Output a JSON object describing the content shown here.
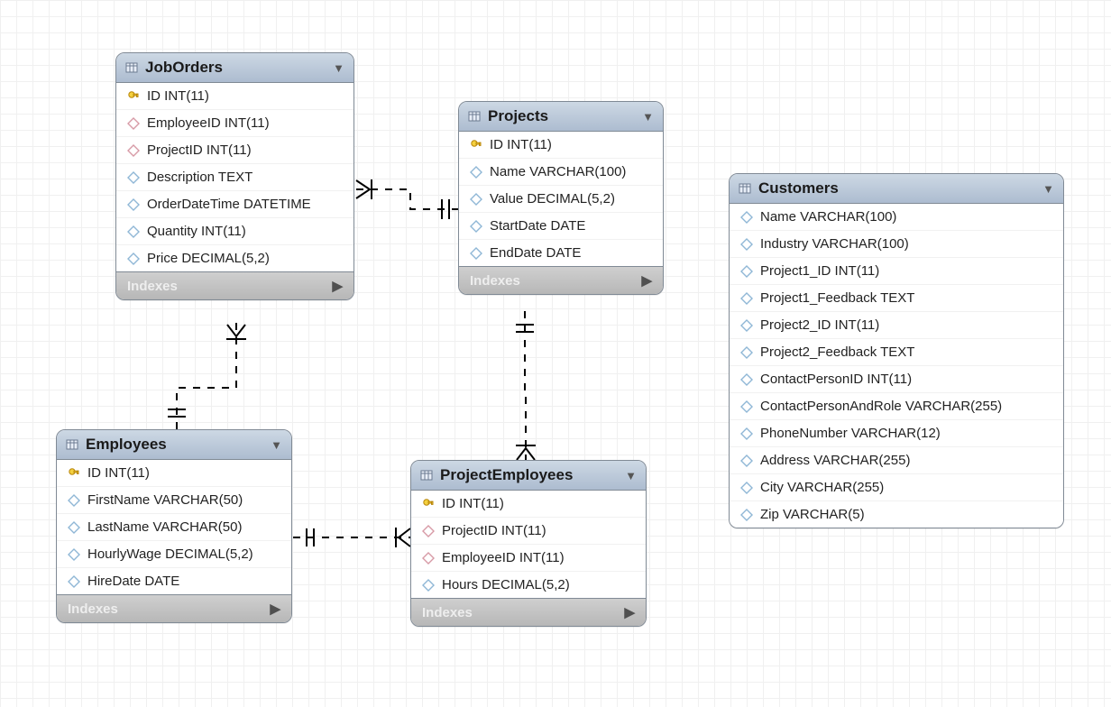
{
  "entities": {
    "joborders": {
      "title": "JobOrders",
      "indexesLabel": "Indexes",
      "columns": [
        {
          "name": "ID INT(11)",
          "type": "pk"
        },
        {
          "name": "EmployeeID INT(11)",
          "type": "fk"
        },
        {
          "name": "ProjectID INT(11)",
          "type": "fk"
        },
        {
          "name": "Description TEXT",
          "type": "col"
        },
        {
          "name": "OrderDateTime DATETIME",
          "type": "col"
        },
        {
          "name": "Quantity INT(11)",
          "type": "col"
        },
        {
          "name": "Price DECIMAL(5,2)",
          "type": "col"
        }
      ]
    },
    "projects": {
      "title": "Projects",
      "indexesLabel": "Indexes",
      "columns": [
        {
          "name": "ID INT(11)",
          "type": "pk"
        },
        {
          "name": "Name VARCHAR(100)",
          "type": "col"
        },
        {
          "name": "Value DECIMAL(5,2)",
          "type": "col"
        },
        {
          "name": "StartDate DATE",
          "type": "col"
        },
        {
          "name": "EndDate DATE",
          "type": "col"
        }
      ]
    },
    "customers": {
      "title": "Customers",
      "columns": [
        {
          "name": "Name VARCHAR(100)",
          "type": "col"
        },
        {
          "name": "Industry VARCHAR(100)",
          "type": "col"
        },
        {
          "name": "Project1_ID INT(11)",
          "type": "col"
        },
        {
          "name": "Project1_Feedback TEXT",
          "type": "col"
        },
        {
          "name": "Project2_ID INT(11)",
          "type": "col"
        },
        {
          "name": "Project2_Feedback TEXT",
          "type": "col"
        },
        {
          "name": "ContactPersonID INT(11)",
          "type": "col"
        },
        {
          "name": "ContactPersonAndRole VARCHAR(255)",
          "type": "col"
        },
        {
          "name": "PhoneNumber VARCHAR(12)",
          "type": "col"
        },
        {
          "name": "Address VARCHAR(255)",
          "type": "col"
        },
        {
          "name": "City VARCHAR(255)",
          "type": "col"
        },
        {
          "name": "Zip VARCHAR(5)",
          "type": "col"
        }
      ]
    },
    "employees": {
      "title": "Employees",
      "indexesLabel": "Indexes",
      "columns": [
        {
          "name": "ID INT(11)",
          "type": "pk"
        },
        {
          "name": "FirstName VARCHAR(50)",
          "type": "col"
        },
        {
          "name": "LastName VARCHAR(50)",
          "type": "col"
        },
        {
          "name": "HourlyWage DECIMAL(5,2)",
          "type": "col"
        },
        {
          "name": "HireDate DATE",
          "type": "col"
        }
      ]
    },
    "projectemployees": {
      "title": "ProjectEmployees",
      "indexesLabel": "Indexes",
      "columns": [
        {
          "name": "ID INT(11)",
          "type": "pk"
        },
        {
          "name": "ProjectID INT(11)",
          "type": "fk"
        },
        {
          "name": "EmployeeID INT(11)",
          "type": "fk"
        },
        {
          "name": "Hours DECIMAL(5,2)",
          "type": "col"
        }
      ]
    }
  },
  "chart_data": {
    "type": "erd",
    "tables": [
      {
        "name": "JobOrders",
        "pk": [
          "ID"
        ],
        "columns": [
          "ID INT(11)",
          "EmployeeID INT(11)",
          "ProjectID INT(11)",
          "Description TEXT",
          "OrderDateTime DATETIME",
          "Quantity INT(11)",
          "Price DECIMAL(5,2)"
        ]
      },
      {
        "name": "Projects",
        "pk": [
          "ID"
        ],
        "columns": [
          "ID INT(11)",
          "Name VARCHAR(100)",
          "Value DECIMAL(5,2)",
          "StartDate DATE",
          "EndDate DATE"
        ]
      },
      {
        "name": "Customers",
        "pk": [],
        "columns": [
          "Name VARCHAR(100)",
          "Industry VARCHAR(100)",
          "Project1_ID INT(11)",
          "Project1_Feedback TEXT",
          "Project2_ID INT(11)",
          "Project2_Feedback TEXT",
          "ContactPersonID INT(11)",
          "ContactPersonAndRole VARCHAR(255)",
          "PhoneNumber VARCHAR(12)",
          "Address VARCHAR(255)",
          "City VARCHAR(255)",
          "Zip VARCHAR(5)"
        ]
      },
      {
        "name": "Employees",
        "pk": [
          "ID"
        ],
        "columns": [
          "ID INT(11)",
          "FirstName VARCHAR(50)",
          "LastName VARCHAR(50)",
          "HourlyWage DECIMAL(5,2)",
          "HireDate DATE"
        ]
      },
      {
        "name": "ProjectEmployees",
        "pk": [
          "ID"
        ],
        "columns": [
          "ID INT(11)",
          "ProjectID INT(11)",
          "EmployeeID INT(11)",
          "Hours DECIMAL(5,2)"
        ]
      }
    ],
    "relationships": [
      {
        "from_table": "JobOrders",
        "from_column": "ProjectID",
        "to_table": "Projects",
        "to_column": "ID",
        "type": "many-to-one",
        "identifying": false
      },
      {
        "from_table": "JobOrders",
        "from_column": "EmployeeID",
        "to_table": "Employees",
        "to_column": "ID",
        "type": "many-to-one",
        "identifying": false
      },
      {
        "from_table": "ProjectEmployees",
        "from_column": "ProjectID",
        "to_table": "Projects",
        "to_column": "ID",
        "type": "many-to-one",
        "identifying": false
      },
      {
        "from_table": "ProjectEmployees",
        "from_column": "EmployeeID",
        "to_table": "Employees",
        "to_column": "ID",
        "type": "many-to-one",
        "identifying": false
      }
    ]
  }
}
